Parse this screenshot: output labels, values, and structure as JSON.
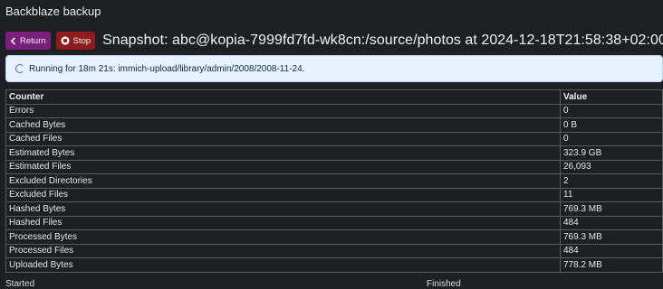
{
  "app": {
    "title": "Backblaze backup"
  },
  "toolbar": {
    "return_label": "Return",
    "stop_label": "Stop"
  },
  "snapshot": {
    "title": "Snapshot: abc@kopia-7999fd7fd-wk8cn:/source/photos at 2024-12-18T21:58:38+02:00"
  },
  "status": {
    "message": "Running for 18m 21s: immich-upload/library/admin/2008/2008-11-24."
  },
  "table": {
    "headers": [
      "Counter",
      "Value"
    ],
    "rows": [
      [
        "Errors",
        "0"
      ],
      [
        "Cached Bytes",
        "0 B"
      ],
      [
        "Cached Files",
        "0"
      ],
      [
        "Estimated Bytes",
        "323.9 GB"
      ],
      [
        "Estimated Files",
        "26,093"
      ],
      [
        "Excluded Directories",
        "2"
      ],
      [
        "Excluded Files",
        "11"
      ],
      [
        "Hashed Bytes",
        "769.3 MB"
      ],
      [
        "Hashed Files",
        "484"
      ],
      [
        "Processed Bytes",
        "769.3 MB"
      ],
      [
        "Processed Files",
        "484"
      ],
      [
        "Uploaded Bytes",
        "778.2 MB"
      ]
    ]
  },
  "footer": {
    "started_label": "Started",
    "finished_label": "Finished"
  },
  "colors": {
    "background": "#1f2023",
    "return_button": "#7a1f7d",
    "stop_button": "#8e1c1c",
    "alert_background": "#e7f1fd",
    "spinner": "#2f6fd1"
  },
  "icons": {
    "return": "chevron-left-icon",
    "stop": "stop-circle-icon",
    "status": "spinner-icon"
  }
}
